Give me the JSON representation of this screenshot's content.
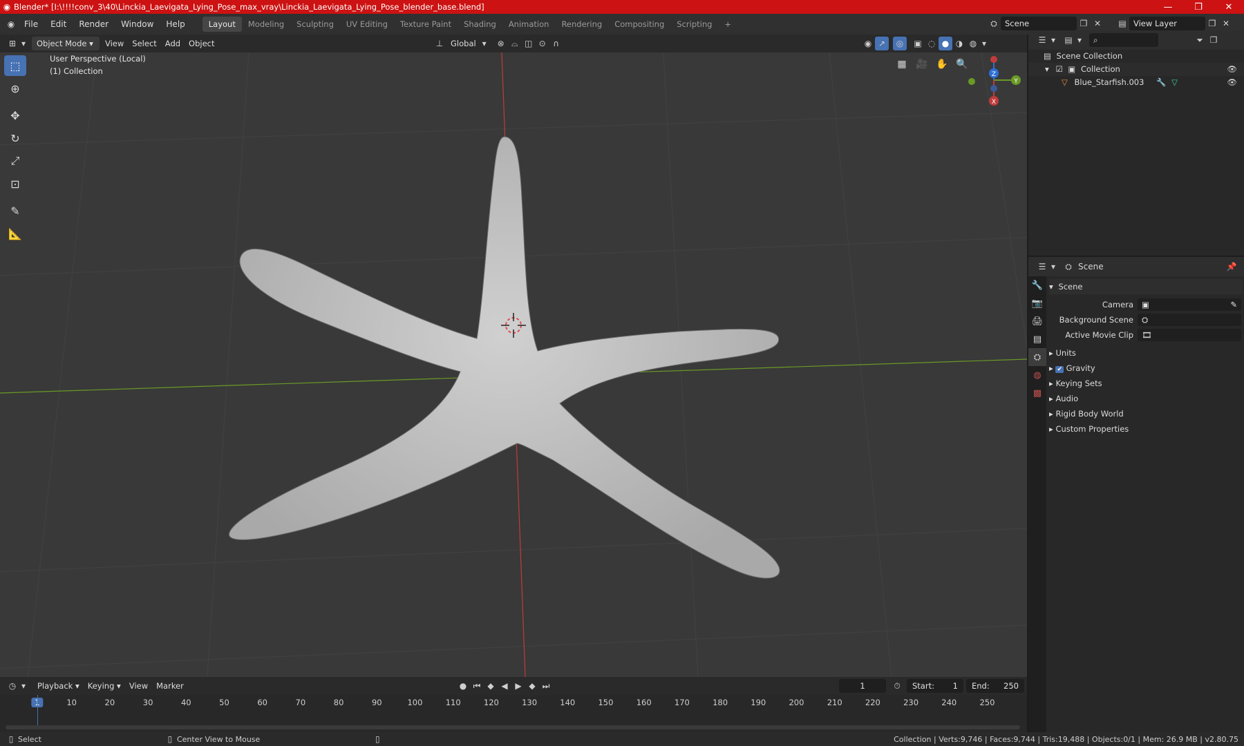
{
  "window": {
    "title": "Blender* [I:\\!!!!conv_3\\40\\Linckia_Laevigata_Lying_Pose_max_vray\\Linckia_Laevigata_Lying_Pose_blender_base.blend]",
    "minimize": "—",
    "maximize": "❐",
    "close": "✕"
  },
  "menu": [
    "File",
    "Edit",
    "Render",
    "Window",
    "Help"
  ],
  "workspaces": [
    "Layout",
    "Modeling",
    "Sculpting",
    "UV Editing",
    "Texture Paint",
    "Shading",
    "Animation",
    "Rendering",
    "Compositing",
    "Scripting"
  ],
  "workspace_add": "+",
  "scene_field": "Scene",
  "view_layer_field": "View Layer",
  "viewport_header": {
    "mode": "Object Mode",
    "menus": [
      "View",
      "Select",
      "Add",
      "Object"
    ],
    "orientation": "Global"
  },
  "viewport": {
    "perspective_label": "User Perspective (Local)",
    "collection_label": "(1) Collection",
    "gizmo": {
      "z": "Z",
      "y": "Y",
      "x": "X"
    },
    "colors": {
      "background": "#393939",
      "grid": "#444444",
      "x_axis": "#c23b3b",
      "y_axis": "#6a9a26",
      "mesh": "#bdbdbd"
    }
  },
  "outliner": {
    "root": "Scene Collection",
    "collection": "Collection",
    "object": "Blue_Starfish.003"
  },
  "properties": {
    "header": "Scene",
    "panel": "Scene",
    "camera_label": "Camera",
    "background_scene_label": "Background Scene",
    "active_movie_clip_label": "Active Movie Clip",
    "sections": [
      "Units",
      "Gravity",
      "Keying Sets",
      "Audio",
      "Rigid Body World",
      "Custom Properties"
    ]
  },
  "timeline": {
    "menus": [
      "Playback",
      "Keying",
      "View",
      "Marker"
    ],
    "current_frame": "1",
    "start_label": "Start:",
    "start": "1",
    "end_label": "End:",
    "end": "250",
    "ticks": [
      "1",
      "10",
      "20",
      "30",
      "40",
      "50",
      "60",
      "70",
      "80",
      "90",
      "100",
      "110",
      "120",
      "130",
      "140",
      "150",
      "160",
      "170",
      "180",
      "190",
      "200",
      "210",
      "220",
      "230",
      "240",
      "250"
    ]
  },
  "statusbar": {
    "select": "Select",
    "center_view": "Center View to Mouse",
    "stats": "Collection | Verts:9,746 | Faces:9,744 | Tris:19,488 | Objects:0/1 | Mem: 26.9 MB | v2.80.75"
  },
  "accent_color": "#4772b3",
  "titlebar_color": "#cc1212"
}
